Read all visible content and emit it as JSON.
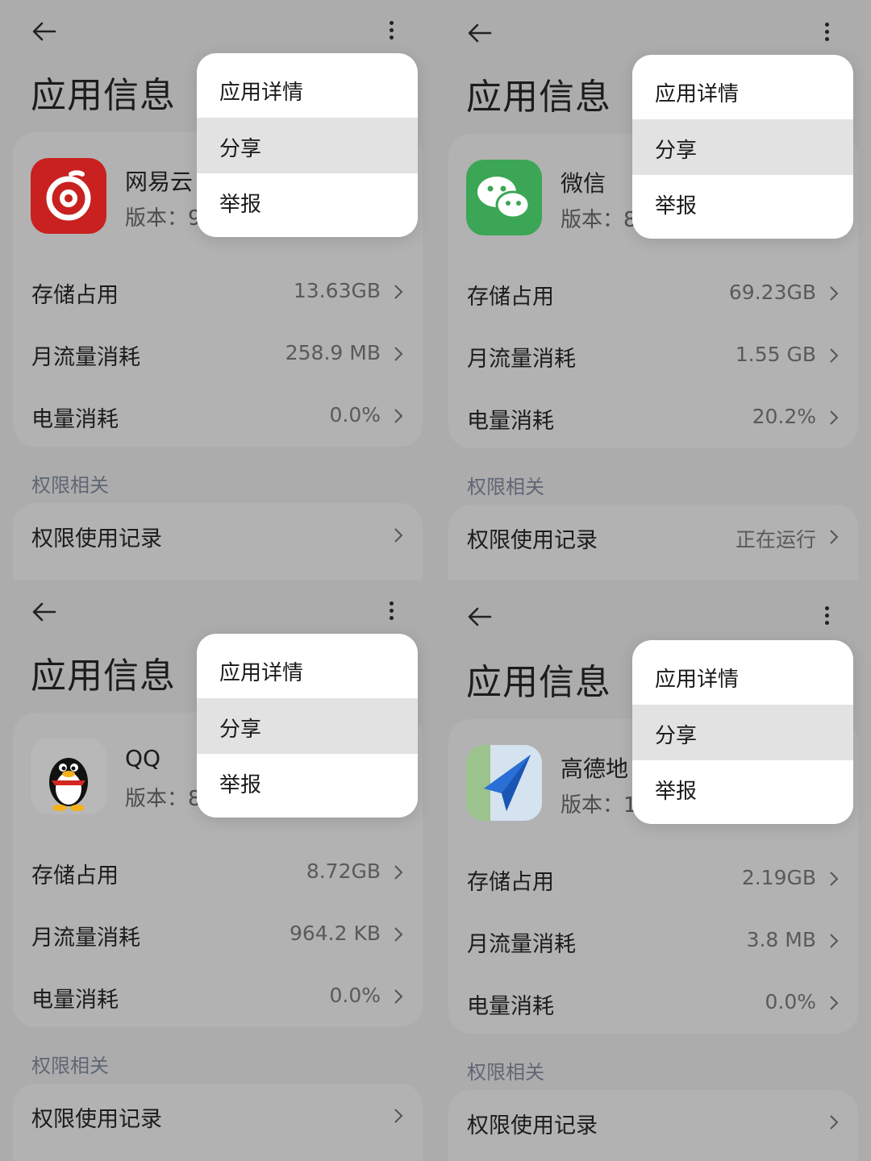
{
  "common": {
    "title": "应用信息",
    "menu": [
      "应用详情",
      "分享",
      "举报"
    ],
    "storage_label": "存储占用",
    "traffic_label": "月流量消耗",
    "battery_label": "电量消耗",
    "perm_section": "权限相关",
    "perm_record_label": "权限使用记录"
  },
  "panels": [
    {
      "app_name": "网易云",
      "version_prefix": "版本：9",
      "storage": "13.63GB",
      "traffic": "258.9 MB",
      "battery": "0.0%",
      "perm_status": "",
      "icon": "netease-music-icon",
      "icon_color": "#c8211f"
    },
    {
      "app_name": "微信",
      "version_prefix": "版本：8",
      "storage": "69.23GB",
      "traffic": "1.55 GB",
      "battery": "20.2%",
      "perm_status": "正在运行",
      "icon": "wechat-icon",
      "icon_color": "#3ba655"
    },
    {
      "app_name": "QQ",
      "version_prefix": "版本：8",
      "storage": "8.72GB",
      "traffic": "964.2 KB",
      "battery": "0.0%",
      "perm_status": "",
      "icon": "qq-penguin-icon",
      "icon_color": "#ffffff"
    },
    {
      "app_name": "高德地",
      "version_prefix": "版本：1",
      "storage": "2.19GB",
      "traffic": "3.8 MB",
      "battery": "0.0%",
      "perm_status": "",
      "icon": "amap-icon",
      "icon_color": "#2a6fd6"
    }
  ]
}
